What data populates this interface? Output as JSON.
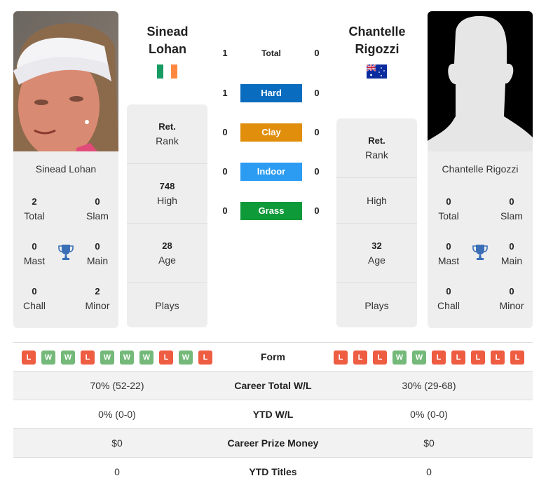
{
  "player1": {
    "name_line1": "Sinead",
    "name_line2": "Lohan",
    "full_name": "Sinead Lohan",
    "country_flag": "ireland-flag",
    "photo": "player-photo",
    "titles": {
      "total": {
        "value": "2",
        "label": "Total"
      },
      "slam": {
        "value": "0",
        "label": "Slam"
      },
      "mast": {
        "value": "0",
        "label": "Mast"
      },
      "main": {
        "value": "0",
        "label": "Main"
      },
      "chall": {
        "value": "0",
        "label": "Chall"
      },
      "minor": {
        "value": "2",
        "label": "Minor"
      }
    },
    "stats": {
      "rank": {
        "value": "Ret.",
        "label": "Rank"
      },
      "high": {
        "value": "748",
        "label": "High"
      },
      "age": {
        "value": "28",
        "label": "Age"
      },
      "plays": {
        "value": "",
        "label": "Plays"
      }
    },
    "form": [
      "L",
      "W",
      "W",
      "L",
      "W",
      "W",
      "W",
      "L",
      "W",
      "L"
    ],
    "career_total_wl": "70% (52-22)",
    "ytd_wl": "0% (0-0)",
    "career_prize_money": "$0",
    "ytd_titles": "0"
  },
  "player2": {
    "name_line1": "Chantelle",
    "name_line2": "Rigozzi",
    "full_name": "Chantelle Rigozzi",
    "country_flag": "australia-flag",
    "photo": "silhouette-placeholder",
    "titles": {
      "total": {
        "value": "0",
        "label": "Total"
      },
      "slam": {
        "value": "0",
        "label": "Slam"
      },
      "mast": {
        "value": "0",
        "label": "Mast"
      },
      "main": {
        "value": "0",
        "label": "Main"
      },
      "chall": {
        "value": "0",
        "label": "Chall"
      },
      "minor": {
        "value": "0",
        "label": "Minor"
      }
    },
    "stats": {
      "rank": {
        "value": "Ret.",
        "label": "Rank"
      },
      "high": {
        "value": "",
        "label": "High"
      },
      "age": {
        "value": "32",
        "label": "Age"
      },
      "plays": {
        "value": "",
        "label": "Plays"
      }
    },
    "form": [
      "L",
      "L",
      "L",
      "W",
      "W",
      "L",
      "L",
      "L",
      "L",
      "L"
    ],
    "career_total_wl": "30% (29-68)",
    "ytd_wl": "0% (0-0)",
    "career_prize_money": "$0",
    "ytd_titles": "0"
  },
  "h2h": [
    {
      "surface": "Total",
      "p1": "1",
      "p2": "0",
      "color": ""
    },
    {
      "surface": "Hard",
      "p1": "1",
      "p2": "0",
      "color": "#0a6cbf"
    },
    {
      "surface": "Clay",
      "p1": "0",
      "p2": "0",
      "color": "#e08e0b"
    },
    {
      "surface": "Indoor",
      "p1": "0",
      "p2": "0",
      "color": "#2b9cf2"
    },
    {
      "surface": "Grass",
      "p1": "0",
      "p2": "0",
      "color": "#0f9a3a"
    }
  ],
  "comparison_labels": {
    "form": "Form",
    "career_total_wl": "Career Total W/L",
    "ytd_wl": "YTD W/L",
    "career_prize_money": "Career Prize Money",
    "ytd_titles": "YTD Titles"
  },
  "colors": {
    "loss": "#ee5c42",
    "win": "#74b979",
    "trophy": "#3a6fb7",
    "card_bg": "#eeeeee"
  }
}
